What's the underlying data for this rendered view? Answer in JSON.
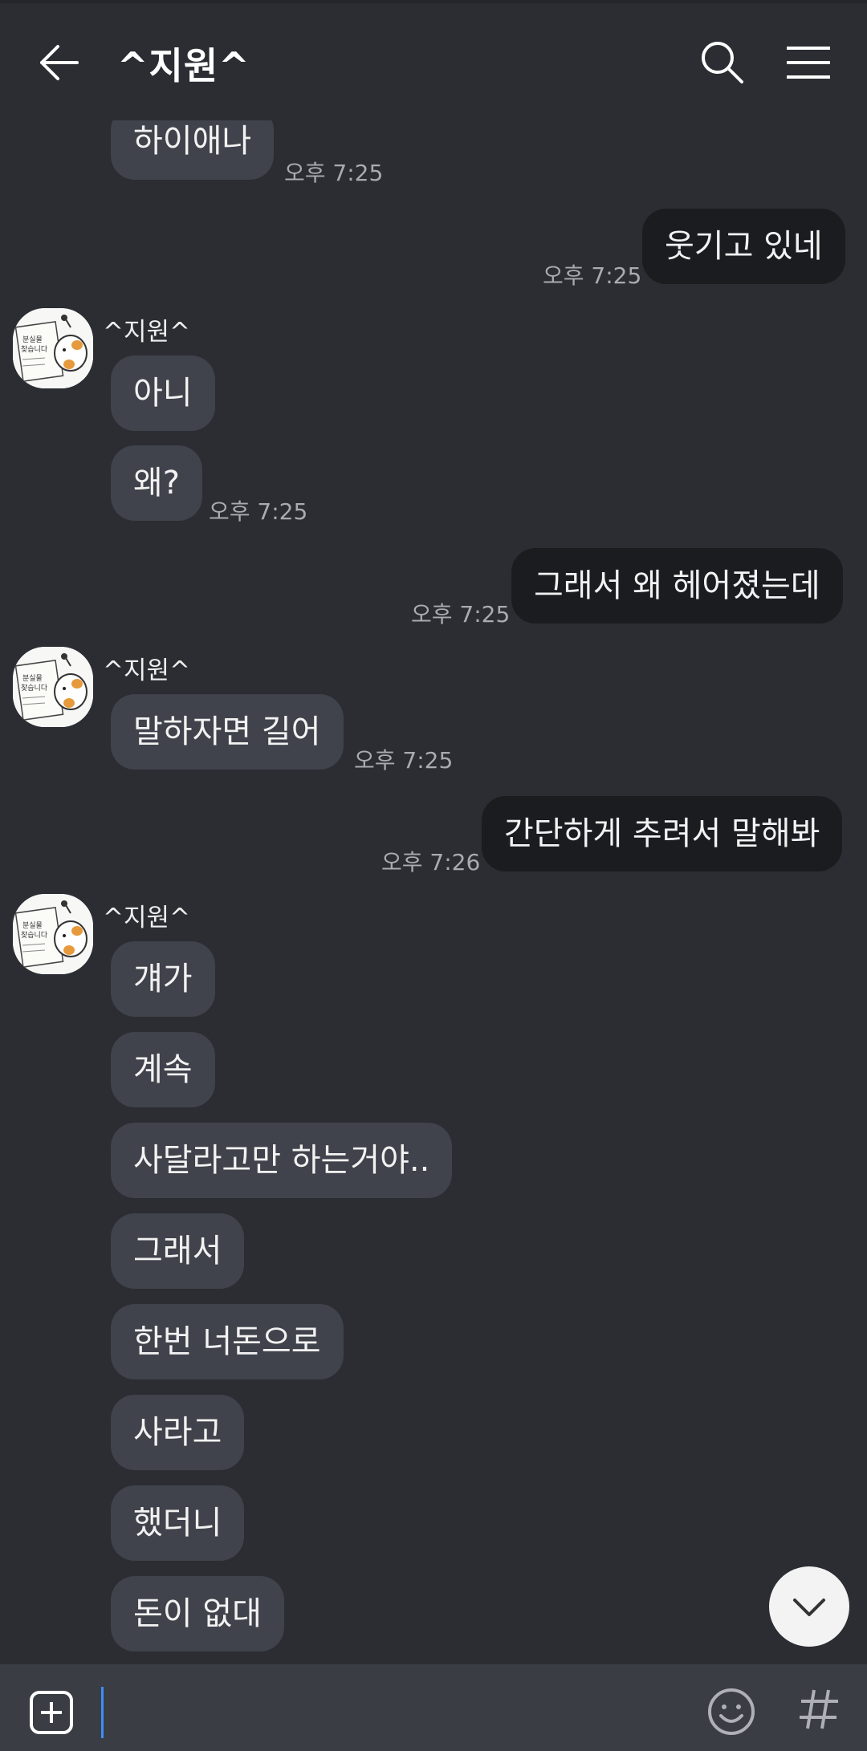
{
  "header": {
    "title": "^지원^",
    "back_icon": "arrow-left-icon",
    "search_icon": "search-icon",
    "menu_icon": "hamburger-menu-icon"
  },
  "contact": {
    "name": "^지원^",
    "avatar_text": [
      "분실물",
      "찾습니다"
    ],
    "avatar_icon": "lost-cat-poster-avatar"
  },
  "messages": [
    {
      "side": "in",
      "text": "하이애나",
      "time": "오후 7:25"
    },
    {
      "side": "out",
      "text": "웃기고 있네",
      "time": "오후 7:25"
    },
    {
      "side": "in",
      "text": "아니"
    },
    {
      "side": "in",
      "text": "왜?",
      "time": "오후 7:25"
    },
    {
      "side": "out",
      "text": "그래서 왜 헤어졌는데",
      "time": "오후 7:25"
    },
    {
      "side": "in",
      "text": "말하자면 길어",
      "time": "오후 7:25"
    },
    {
      "side": "out",
      "text": "간단하게 추려서 말해봐",
      "time": "오후 7:26"
    },
    {
      "side": "in",
      "text": "걔가"
    },
    {
      "side": "in",
      "text": "계속"
    },
    {
      "side": "in",
      "text": "사달라고만 하는거야.."
    },
    {
      "side": "in",
      "text": "그래서"
    },
    {
      "side": "in",
      "text": "한번 너돈으로"
    },
    {
      "side": "in",
      "text": "사라고"
    },
    {
      "side": "in",
      "text": "했더니"
    },
    {
      "side": "in",
      "text": "돈이 없대"
    }
  ],
  "composer": {
    "plus_icon": "plus-square-icon",
    "emoji_icon": "emoji-icon",
    "hash_icon": "hashtag-icon",
    "scroll_icon": "chevron-down-icon"
  },
  "colors": {
    "background": "#2b2d33",
    "incoming_bubble": "#40434b",
    "outgoing_bubble": "#1b1c20",
    "cursor": "#3e8ef7"
  }
}
